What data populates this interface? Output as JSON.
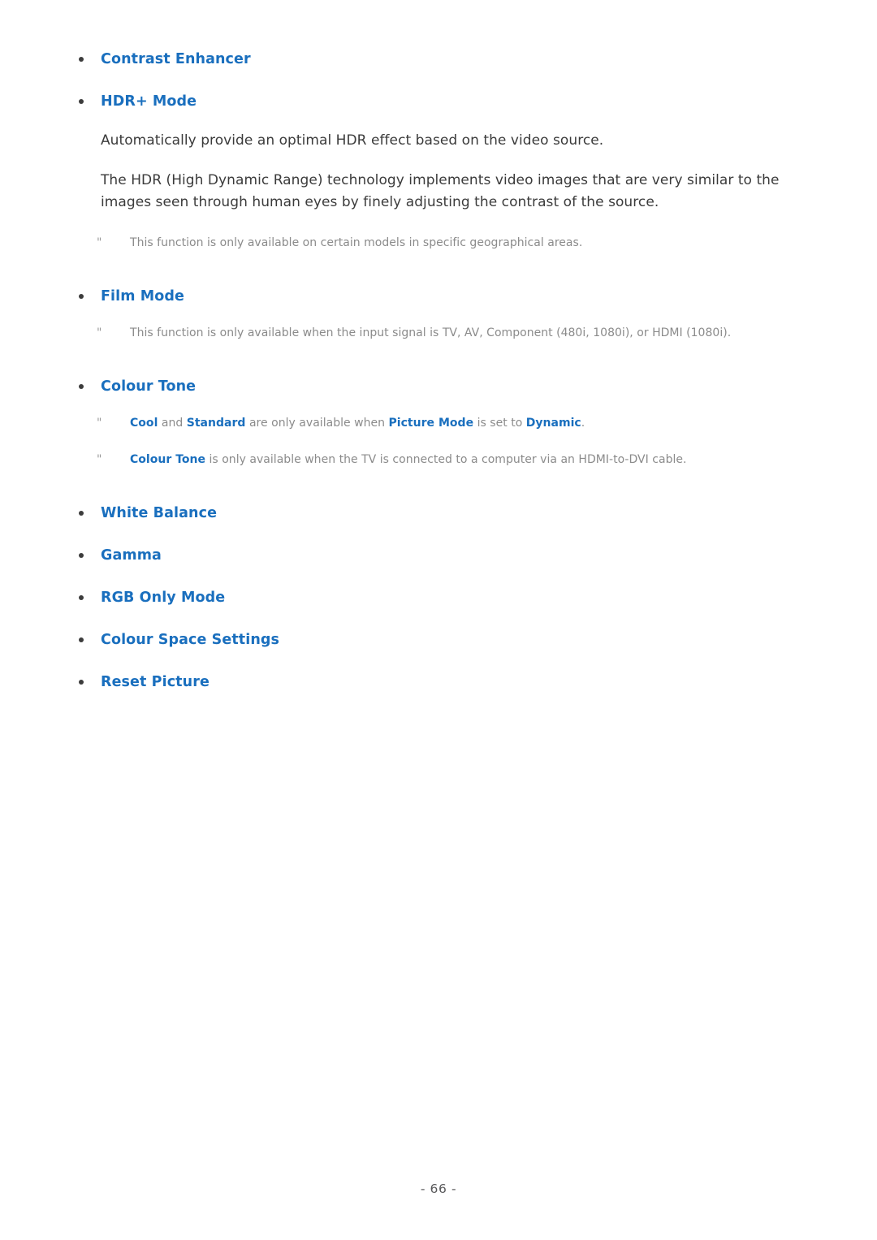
{
  "page": {
    "footer_label": "- 66 -",
    "accent_color": "#1a6fbe",
    "body_color": "#3b3b3b",
    "note_color": "#8b8b8b",
    "background_color": "#ffffff"
  },
  "sections": {
    "contrast_enhancer": {
      "label": "Contrast Enhancer"
    },
    "hdr_plus_mode": {
      "label": "HDR+ Mode",
      "paragraph_1": "Automatically provide an optimal HDR effect based on the video source.",
      "paragraph_2": "The HDR (High Dynamic Range) technology implements video images that are very similar to the images seen through human eyes by finely adjusting the contrast of the source.",
      "note_1": "This function is only available on certain models in specific geographical areas."
    },
    "film_mode": {
      "label": "Film Mode",
      "note_1": "This function is only available when the input signal is TV, AV, Component (480i, 1080i), or HDMI (1080i)."
    },
    "colour_tone": {
      "label": "Colour Tone",
      "note_1": {
        "term_1": "Cool",
        "text_1": " and ",
        "term_2": "Standard",
        "text_2": " are only available when ",
        "term_3": "Picture Mode",
        "text_3": " is set to ",
        "term_4": "Dynamic",
        "text_4": "."
      },
      "note_2": {
        "term_1": "Colour Tone",
        "text_1": " is only available when the TV is connected to a computer via an HDMI-to-DVI cable."
      }
    },
    "white_balance": {
      "label": "White Balance"
    },
    "gamma": {
      "label": "Gamma"
    },
    "rgb_only_mode": {
      "label": "RGB Only Mode"
    },
    "colour_space_settings": {
      "label": "Colour Space Settings"
    },
    "reset_picture": {
      "label": "Reset Picture"
    }
  },
  "icons": {
    "bullet": "bullet-dot-icon",
    "note_mark": "\""
  }
}
